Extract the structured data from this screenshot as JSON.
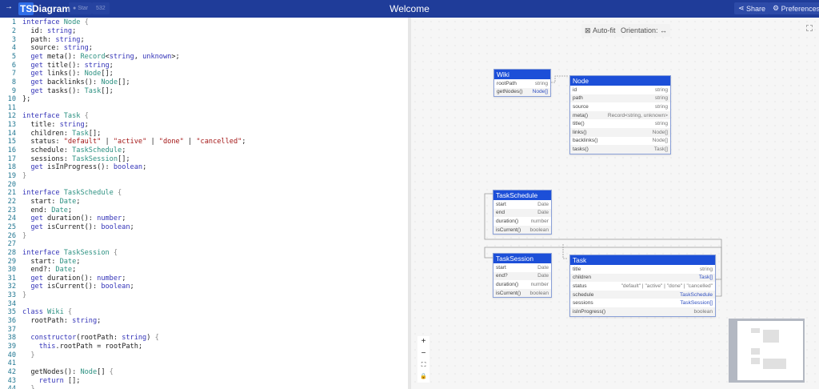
{
  "header": {
    "menu_icon": "arrow-right-icon",
    "logo_badge": "TS",
    "logo_text": "Diagram",
    "star_label": "Star",
    "star_count": "532",
    "title": "Welcome",
    "share_label": "Share",
    "preferences_label": "Preferences",
    "colors": {
      "header": "#1f3c99",
      "node_header": "#1c4fd8"
    }
  },
  "editor": {
    "lines": [
      [
        [
          "k",
          "interface "
        ],
        [
          "t",
          "Node "
        ],
        [
          "b",
          "{"
        ]
      ],
      [
        [
          "p",
          "  id: "
        ],
        [
          "k",
          "string"
        ],
        [
          "p",
          ";"
        ]
      ],
      [
        [
          "p",
          "  path: "
        ],
        [
          "k",
          "string"
        ],
        [
          "p",
          ";"
        ]
      ],
      [
        [
          "p",
          "  source: "
        ],
        [
          "k",
          "string"
        ],
        [
          "p",
          ";"
        ]
      ],
      [
        [
          "k",
          "  get "
        ],
        [
          "p",
          "meta(): "
        ],
        [
          "t",
          "Record"
        ],
        [
          "p",
          "<"
        ],
        [
          "k",
          "string"
        ],
        [
          "p",
          ", "
        ],
        [
          "k",
          "unknown"
        ],
        [
          "p",
          ">;"
        ]
      ],
      [
        [
          "k",
          "  get "
        ],
        [
          "p",
          "title(): "
        ],
        [
          "k",
          "string"
        ],
        [
          "p",
          ";"
        ]
      ],
      [
        [
          "k",
          "  get "
        ],
        [
          "p",
          "links(): "
        ],
        [
          "t",
          "Node"
        ],
        [
          "p",
          "[];"
        ]
      ],
      [
        [
          "k",
          "  get "
        ],
        [
          "p",
          "backlinks(): "
        ],
        [
          "t",
          "Node"
        ],
        [
          "p",
          "[];"
        ]
      ],
      [
        [
          "k",
          "  get "
        ],
        [
          "p",
          "tasks(): "
        ],
        [
          "t",
          "Task"
        ],
        [
          "p",
          "[];"
        ]
      ],
      [
        [
          "p",
          "};"
        ]
      ],
      [
        [
          "p",
          ""
        ]
      ],
      [
        [
          "k",
          "interface "
        ],
        [
          "t",
          "Task "
        ],
        [
          "b",
          "{"
        ]
      ],
      [
        [
          "p",
          "  title: "
        ],
        [
          "k",
          "string"
        ],
        [
          "p",
          ";"
        ]
      ],
      [
        [
          "p",
          "  children: "
        ],
        [
          "t",
          "Task"
        ],
        [
          "p",
          "[];"
        ]
      ],
      [
        [
          "p",
          "  status: "
        ],
        [
          "s",
          "\"default\""
        ],
        [
          "p",
          " | "
        ],
        [
          "s",
          "\"active\""
        ],
        [
          "p",
          " | "
        ],
        [
          "s",
          "\"done\""
        ],
        [
          "p",
          " | "
        ],
        [
          "s",
          "\"cancelled\""
        ],
        [
          "p",
          ";"
        ]
      ],
      [
        [
          "p",
          "  schedule: "
        ],
        [
          "t",
          "TaskSchedule"
        ],
        [
          "p",
          ";"
        ]
      ],
      [
        [
          "p",
          "  sessions: "
        ],
        [
          "t",
          "TaskSession"
        ],
        [
          "p",
          "[];"
        ]
      ],
      [
        [
          "k",
          "  get "
        ],
        [
          "p",
          "isInProgress(): "
        ],
        [
          "k",
          "boolean"
        ],
        [
          "p",
          ";"
        ]
      ],
      [
        [
          "b",
          "}"
        ]
      ],
      [
        [
          "p",
          ""
        ]
      ],
      [
        [
          "k",
          "interface "
        ],
        [
          "t",
          "TaskSchedule "
        ],
        [
          "b",
          "{"
        ]
      ],
      [
        [
          "p",
          "  start: "
        ],
        [
          "t",
          "Date"
        ],
        [
          "p",
          ";"
        ]
      ],
      [
        [
          "p",
          "  end: "
        ],
        [
          "t",
          "Date"
        ],
        [
          "p",
          ";"
        ]
      ],
      [
        [
          "k",
          "  get "
        ],
        [
          "p",
          "duration(): "
        ],
        [
          "k",
          "number"
        ],
        [
          "p",
          ";"
        ]
      ],
      [
        [
          "k",
          "  get "
        ],
        [
          "p",
          "isCurrent(): "
        ],
        [
          "k",
          "boolean"
        ],
        [
          "p",
          ";"
        ]
      ],
      [
        [
          "b",
          "}"
        ]
      ],
      [
        [
          "p",
          ""
        ]
      ],
      [
        [
          "k",
          "interface "
        ],
        [
          "t",
          "TaskSession "
        ],
        [
          "b",
          "{"
        ]
      ],
      [
        [
          "p",
          "  start: "
        ],
        [
          "t",
          "Date"
        ],
        [
          "p",
          ";"
        ]
      ],
      [
        [
          "p",
          "  end?: "
        ],
        [
          "t",
          "Date"
        ],
        [
          "p",
          ";"
        ]
      ],
      [
        [
          "k",
          "  get "
        ],
        [
          "p",
          "duration(): "
        ],
        [
          "k",
          "number"
        ],
        [
          "p",
          ";"
        ]
      ],
      [
        [
          "k",
          "  get "
        ],
        [
          "p",
          "isCurrent(): "
        ],
        [
          "k",
          "boolean"
        ],
        [
          "p",
          ";"
        ]
      ],
      [
        [
          "b",
          "}"
        ]
      ],
      [
        [
          "p",
          ""
        ]
      ],
      [
        [
          "k",
          "class "
        ],
        [
          "t",
          "Wiki "
        ],
        [
          "b",
          "{"
        ]
      ],
      [
        [
          "p",
          "  rootPath: "
        ],
        [
          "k",
          "string"
        ],
        [
          "p",
          ";"
        ]
      ],
      [
        [
          "p",
          ""
        ]
      ],
      [
        [
          "k",
          "  constructor"
        ],
        [
          "p",
          "(rootPath: "
        ],
        [
          "k",
          "string"
        ],
        [
          "p",
          ") "
        ],
        [
          "b",
          "{"
        ]
      ],
      [
        [
          "k",
          "    this"
        ],
        [
          "p",
          ".rootPath = rootPath;"
        ]
      ],
      [
        [
          "b",
          "  }"
        ]
      ],
      [
        [
          "p",
          ""
        ]
      ],
      [
        [
          "p",
          "  getNodes(): "
        ],
        [
          "t",
          "Node"
        ],
        [
          "p",
          "[] "
        ],
        [
          "b",
          "{"
        ]
      ],
      [
        [
          "k",
          "    return "
        ],
        [
          "p",
          "[];"
        ]
      ],
      [
        [
          "b",
          "  }"
        ]
      ]
    ]
  },
  "toolbar": {
    "autofit_label": "Auto-fit",
    "orientation_label": "Orientation: ↔"
  },
  "diagram": {
    "nodes": [
      {
        "name": "Wiki",
        "rows": [
          [
            "rootPath",
            "string"
          ],
          [
            "getNodes()",
            "Node[]"
          ]
        ]
      },
      {
        "name": "Node",
        "rows": [
          [
            "id",
            "string"
          ],
          [
            "path",
            "string"
          ],
          [
            "source",
            "string"
          ],
          [
            "meta()",
            "Record<string, unknown>"
          ],
          [
            "title()",
            "string"
          ],
          [
            "links()",
            "Node[]"
          ],
          [
            "backlinks()",
            "Node[]"
          ],
          [
            "tasks()",
            "Task[]"
          ]
        ]
      },
      {
        "name": "TaskSchedule",
        "rows": [
          [
            "start",
            "Date"
          ],
          [
            "end",
            "Date"
          ],
          [
            "duration()",
            "number"
          ],
          [
            "isCurrent()",
            "boolean"
          ]
        ]
      },
      {
        "name": "TaskSession",
        "rows": [
          [
            "start",
            "Date"
          ],
          [
            "end?",
            "Date"
          ],
          [
            "duration()",
            "number"
          ],
          [
            "isCurrent()",
            "boolean"
          ]
        ]
      },
      {
        "name": "Task",
        "rows": [
          [
            "title",
            "string"
          ],
          [
            "children",
            "Task[]"
          ],
          [
            "status",
            "\"default\" | \"active\" | \"done\" | \"cancelled\""
          ],
          [
            "schedule",
            "TaskSchedule"
          ],
          [
            "sessions",
            "TaskSession[]"
          ],
          [
            "isInProgress()",
            "boolean"
          ]
        ]
      }
    ]
  },
  "controls": {
    "zoom_in": "+",
    "zoom_out": "−",
    "fit": "⛶",
    "lock": "🔒"
  }
}
